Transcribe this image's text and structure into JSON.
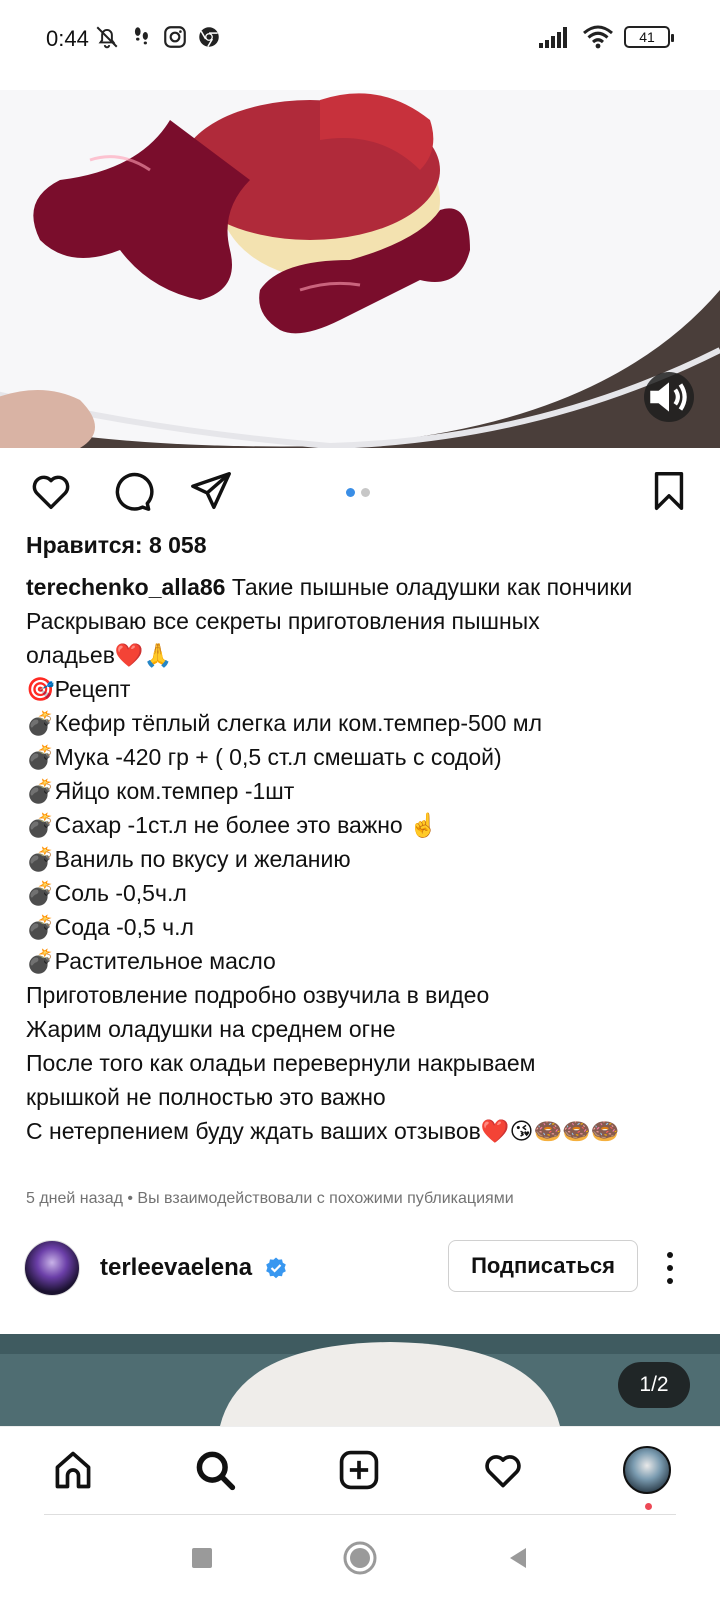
{
  "status_bar": {
    "time": "0:44",
    "battery": "41",
    "icons_left": [
      "muted-bell-icon",
      "footsteps-icon",
      "instagram-icon",
      "chrome-icon"
    ],
    "icons_right": [
      "signal-icon",
      "wifi-icon",
      "battery-icon"
    ]
  },
  "post": {
    "likes_label": "Нравится: 8 058",
    "username": "terechenko_alla86",
    "caption_lines": [
      "Такие пышные оладушки как пончики",
      "Раскрываю все секреты приготовления пышных",
      "оладьев❤️🙏",
      "🎯Рецепт",
      "💣Кефир тёплый слегка или ком.темпер-500 мл",
      "💣Мука -420 гр + ( 0,5 ст.л смешать с содой)",
      "💣Яйцо ком.темпер -1шт",
      "💣Сахар -1ст.л не более это важно ☝️",
      "💣Ваниль по вкусу и желанию",
      "💣Соль -0,5ч.л",
      "💣Сода -0,5 ч.л",
      "💣Растительное масло",
      "Приготовление подробно озвучила в видео",
      "Жарим оладушки на среднем огне",
      "После того как оладьи перевернули накрываем",
      "крышкой не полностью это важно",
      "С нетерпением буду ждать ваших отзывов❤️😘🍩🍩🍩"
    ],
    "meta": "5 дней назад • Вы взаимодействовали с похожими публикациями",
    "carousel": {
      "count": 2,
      "active_index": 0
    },
    "accent_color": "#3a8ee6"
  },
  "next_post": {
    "username": "terleevaelena",
    "verified": true,
    "follow_label": "Подписаться",
    "page_counter": "1/2"
  },
  "bottom_nav": {
    "items": [
      "home-icon",
      "search-icon",
      "create-post-icon",
      "activity-heart-icon",
      "profile-avatar"
    ]
  },
  "system_nav": {
    "items": [
      "recents-square-icon",
      "home-circle-icon",
      "back-triangle-icon"
    ]
  }
}
